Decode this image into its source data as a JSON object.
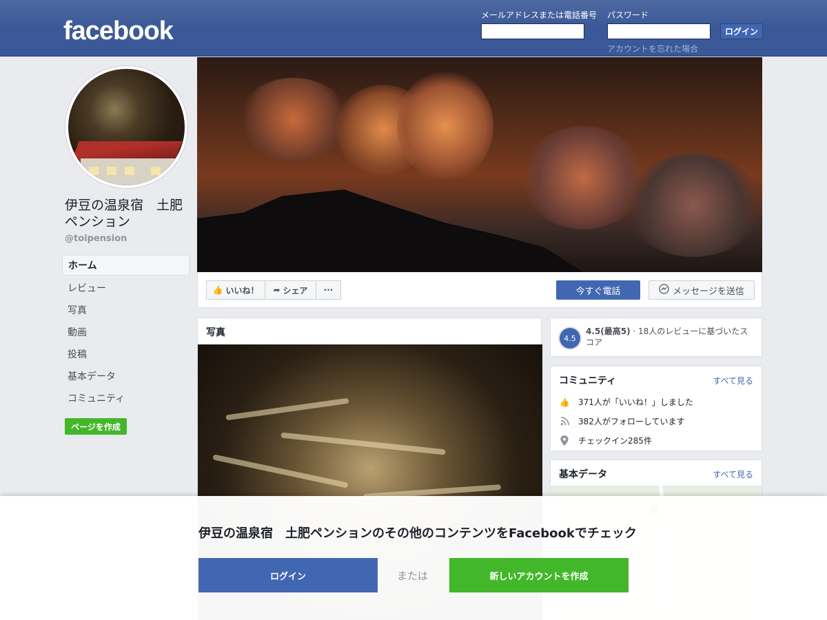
{
  "header": {
    "logo": "facebook",
    "email_label": "メールアドレスまたは電話番号",
    "password_label": "パスワード",
    "login_button": "ログイン",
    "forgot_link": "アカウントを忘れた場合"
  },
  "page": {
    "name": "伊豆の温泉宿　土肥ペンション",
    "handle": "@toipension"
  },
  "nav": {
    "items": [
      {
        "label": "ホーム",
        "active": true
      },
      {
        "label": "レビュー"
      },
      {
        "label": "写真"
      },
      {
        "label": "動画"
      },
      {
        "label": "投稿"
      },
      {
        "label": "基本データ"
      },
      {
        "label": "コミュニティ"
      }
    ],
    "create_page": "ページを作成"
  },
  "actions": {
    "like": "いいね！",
    "share": "シェア",
    "more": "···",
    "call": "今すぐ電話",
    "message": "メッセージを送信"
  },
  "photos": {
    "title": "写真"
  },
  "rating": {
    "score": "4.5",
    "summary_bold": "4.5(最高5)",
    "summary_rest": " · 18人のレビューに基づいたスコア"
  },
  "community": {
    "title": "コミュニティ",
    "see_all": "すべて見る",
    "likes": "371人が「いいね！」しました",
    "follows": "382人がフォローしています",
    "checkins": "チェックイン285件"
  },
  "about": {
    "title": "基本データ",
    "see_all": "すべて見る"
  },
  "overlay": {
    "title": "伊豆の温泉宿　土肥ペンションのその他のコンテンツをFacebookでチェック",
    "login": "ログイン",
    "or": "または",
    "create": "新しいアカウントを作成"
  },
  "colors": {
    "brand_blue": "#3b5998",
    "button_blue": "#4267b2",
    "green": "#42b72a"
  }
}
